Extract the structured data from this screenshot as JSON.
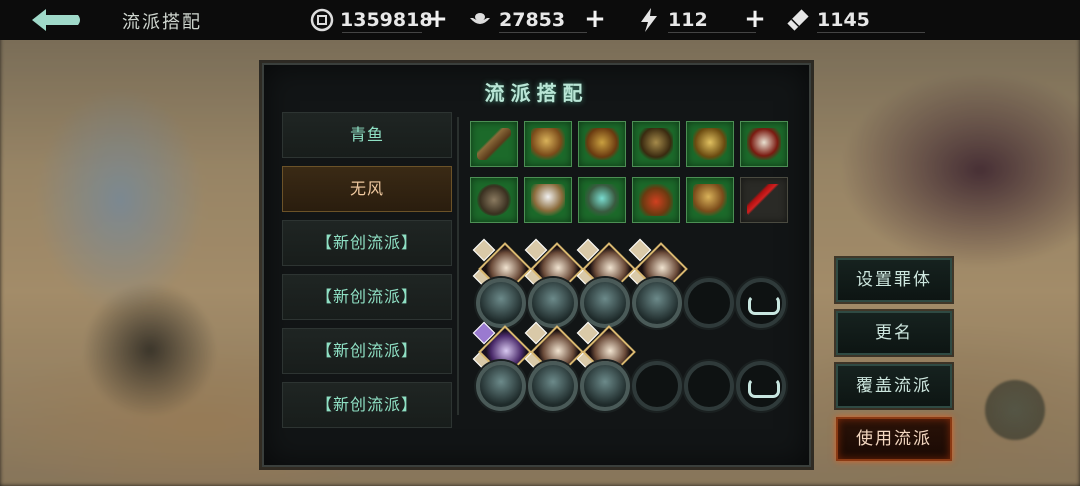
{
  "header": {
    "title": "流派搭配",
    "resources": [
      {
        "icon": "coin-icon",
        "value": "1359818"
      },
      {
        "icon": "ingot-icon",
        "value": "27853"
      },
      {
        "icon": "lightning-icon",
        "value": "112"
      },
      {
        "icon": "ticket-icon",
        "value": "1145"
      }
    ]
  },
  "panel": {
    "title": "流派搭配",
    "schools": [
      {
        "label": "青鱼",
        "active": false
      },
      {
        "label": "无风",
        "active": true
      },
      {
        "label": "【新创流派】",
        "active": false
      },
      {
        "label": "【新创流派】",
        "active": false
      },
      {
        "label": "【新创流派】",
        "active": false
      },
      {
        "label": "【新创流派】",
        "active": false
      }
    ]
  },
  "actions": {
    "set_body": "设置罪体",
    "rename": "更名",
    "overwrite": "覆盖流派",
    "use": "使用流派"
  },
  "colors": {
    "accent": "#8fe0c4",
    "active": "#f0c9a0",
    "use_border": "#8a3a14"
  }
}
